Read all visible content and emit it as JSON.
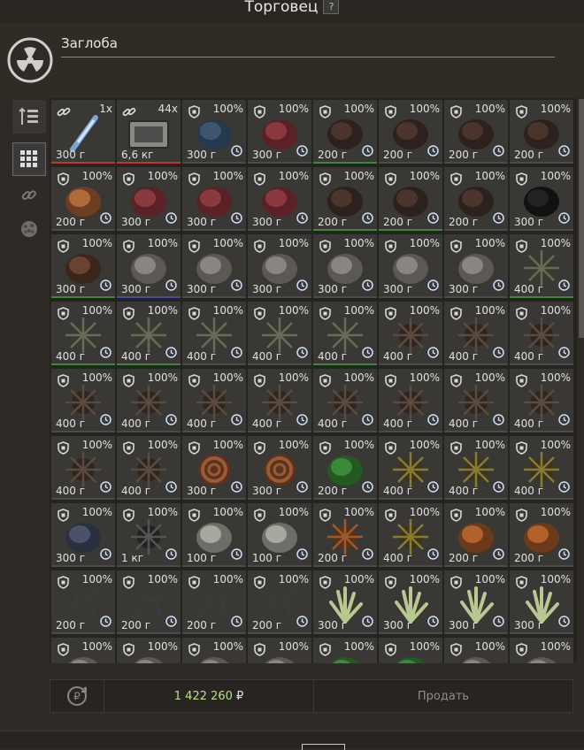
{
  "window": {
    "title": "Торговец",
    "help_label": "?"
  },
  "trader": {
    "name": "Заглоба",
    "avatar_icon": "radiation-icon"
  },
  "sidebar": {
    "buttons": [
      {
        "icon": "sort-icon"
      },
      {
        "icon": "grid-icon"
      },
      {
        "icon": "link-icon"
      },
      {
        "icon": "artifact-icon"
      }
    ]
  },
  "grid": {
    "columns": 8,
    "cells": [
      {
        "type": "link",
        "count": "1x",
        "weight": "300 г",
        "art": "injector",
        "bar": "#c0392b"
      },
      {
        "type": "link",
        "count": "44x",
        "weight": "6,6 кг",
        "art": "case",
        "bar": "#c0392b"
      },
      {
        "type": "shield",
        "pct": "100%",
        "weight": "300 г",
        "art": "blue",
        "bar": "#4a4a4a"
      },
      {
        "type": "shield",
        "pct": "100%",
        "weight": "300 г",
        "art": "red",
        "bar": "#4a4a4a"
      },
      {
        "type": "shield",
        "pct": "100%",
        "weight": "200 г",
        "art": "dark",
        "bar": "#3a8a3a"
      },
      {
        "type": "shield",
        "pct": "100%",
        "weight": "200 г",
        "art": "dark",
        "bar": "#4a4a4a"
      },
      {
        "type": "shield",
        "pct": "100%",
        "weight": "200 г",
        "art": "dark",
        "bar": "#4a4a4a"
      },
      {
        "type": "shield",
        "pct": "100%",
        "weight": "200 г",
        "art": "dark",
        "bar": "#4a4a4a"
      },
      {
        "type": "shield",
        "pct": "100%",
        "weight": "200 г",
        "art": "orange",
        "bar": "#4a4a4a"
      },
      {
        "type": "shield",
        "pct": "100%",
        "weight": "300 г",
        "art": "red",
        "bar": "#4a4a4a"
      },
      {
        "type": "shield",
        "pct": "100%",
        "weight": "300 г",
        "art": "red",
        "bar": "#4a4a4a"
      },
      {
        "type": "shield",
        "pct": "100%",
        "weight": "300 г",
        "art": "red",
        "bar": "#4a4a4a"
      },
      {
        "type": "shield",
        "pct": "100%",
        "weight": "200 г",
        "art": "dark",
        "bar": "#3a8a3a"
      },
      {
        "type": "shield",
        "pct": "100%",
        "weight": "200 г",
        "art": "dark",
        "bar": "#3a8a3a"
      },
      {
        "type": "shield",
        "pct": "100%",
        "weight": "200 г",
        "art": "dark",
        "bar": "#4a4a4a"
      },
      {
        "type": "shield",
        "pct": "100%",
        "weight": "300 г",
        "art": "black",
        "bar": "#4a4a4a"
      },
      {
        "type": "shield",
        "pct": "100%",
        "weight": "300 г",
        "art": "brown",
        "bar": "#3a8a3a"
      },
      {
        "type": "shield",
        "pct": "100%",
        "weight": "300 г",
        "art": "grey",
        "bar": "#4a4aa0"
      },
      {
        "type": "shield",
        "pct": "100%",
        "weight": "300 г",
        "art": "grey",
        "bar": "#4a4a4a"
      },
      {
        "type": "shield",
        "pct": "100%",
        "weight": "300 г",
        "art": "grey",
        "bar": "#4a4a4a"
      },
      {
        "type": "shield",
        "pct": "100%",
        "weight": "300 г",
        "art": "grey",
        "bar": "#4a4a4a"
      },
      {
        "type": "shield",
        "pct": "100%",
        "weight": "300 г",
        "art": "grey",
        "bar": "#4a4a4a"
      },
      {
        "type": "shield",
        "pct": "100%",
        "weight": "300 г",
        "art": "grey",
        "bar": "#4a4a4a"
      },
      {
        "type": "shield",
        "pct": "100%",
        "weight": "400 г",
        "art": "spiky",
        "bar": "#3a8a3a"
      },
      {
        "type": "shield",
        "pct": "100%",
        "weight": "400 г",
        "art": "spiky",
        "bar": "#3a8a3a"
      },
      {
        "type": "shield",
        "pct": "100%",
        "weight": "400 г",
        "art": "spiky",
        "bar": "#3a8a3a"
      },
      {
        "type": "shield",
        "pct": "100%",
        "weight": "400 г",
        "art": "spiky",
        "bar": "#4a4a4a"
      },
      {
        "type": "shield",
        "pct": "100%",
        "weight": "400 г",
        "art": "spiky",
        "bar": "#4a4a4a"
      },
      {
        "type": "shield",
        "pct": "100%",
        "weight": "400 г",
        "art": "spiky",
        "bar": "#3a8a3a"
      },
      {
        "type": "shield",
        "pct": "100%",
        "weight": "400 г",
        "art": "darkspiky",
        "bar": "#4a4a4a"
      },
      {
        "type": "shield",
        "pct": "100%",
        "weight": "400 г",
        "art": "darkspiky",
        "bar": "#4a4a4a"
      },
      {
        "type": "shield",
        "pct": "100%",
        "weight": "400 г",
        "art": "darkspiky",
        "bar": "#4a4a4a"
      },
      {
        "type": "shield",
        "pct": "100%",
        "weight": "400 г",
        "art": "darkspiky",
        "bar": "#4a4a4a"
      },
      {
        "type": "shield",
        "pct": "100%",
        "weight": "400 г",
        "art": "darkspiky",
        "bar": "#4a4a4a"
      },
      {
        "type": "shield",
        "pct": "100%",
        "weight": "400 г",
        "art": "darkspiky",
        "bar": "#4a4a4a"
      },
      {
        "type": "shield",
        "pct": "100%",
        "weight": "400 г",
        "art": "darkspiky",
        "bar": "#4a4a4a"
      },
      {
        "type": "shield",
        "pct": "100%",
        "weight": "400 г",
        "art": "darkspiky",
        "bar": "#4a4a4a"
      },
      {
        "type": "shield",
        "pct": "100%",
        "weight": "400 г",
        "art": "darkspiky",
        "bar": "#4a4a4a"
      },
      {
        "type": "shield",
        "pct": "100%",
        "weight": "400 г",
        "art": "darkspiky",
        "bar": "#4a4a4a"
      },
      {
        "type": "shield",
        "pct": "100%",
        "weight": "400 г",
        "art": "darkspiky",
        "bar": "#4a4a4a"
      },
      {
        "type": "shield",
        "pct": "100%",
        "weight": "400 г",
        "art": "darkspiky",
        "bar": "#4a4a4a"
      },
      {
        "type": "shield",
        "pct": "100%",
        "weight": "400 г",
        "art": "darkspiky",
        "bar": "#4a4a4a"
      },
      {
        "type": "shield",
        "pct": "100%",
        "weight": "300 г",
        "art": "spiral",
        "bar": "#4a4a4a"
      },
      {
        "type": "shield",
        "pct": "100%",
        "weight": "300 г",
        "art": "spiral",
        "bar": "#4a4a4a"
      },
      {
        "type": "shield",
        "pct": "100%",
        "weight": "200 г",
        "art": "green",
        "bar": "#4a4a4a"
      },
      {
        "type": "shield",
        "pct": "100%",
        "weight": "400 г",
        "art": "goldspiky",
        "bar": "#4a4a4a"
      },
      {
        "type": "shield",
        "pct": "100%",
        "weight": "400 г",
        "art": "goldspiky",
        "bar": "#4a4a4a"
      },
      {
        "type": "shield",
        "pct": "100%",
        "weight": "400 г",
        "art": "goldspiky",
        "bar": "#4a4a4a"
      },
      {
        "type": "shield",
        "pct": "100%",
        "weight": "300 г",
        "art": "navy",
        "bar": "#4a4a4a"
      },
      {
        "type": "shield",
        "pct": "100%",
        "weight": "1 кг",
        "art": "blackstar",
        "bar": "#4a4a4a"
      },
      {
        "type": "shield",
        "pct": "100%",
        "weight": "100 г",
        "art": "whitegrey",
        "bar": "#4a4a4a"
      },
      {
        "type": "shield",
        "pct": "100%",
        "weight": "100 г",
        "art": "whitegrey",
        "bar": "#4a4a4a"
      },
      {
        "type": "shield",
        "pct": "100%",
        "weight": "200 г",
        "art": "orangespiky",
        "bar": "#4a4a4a"
      },
      {
        "type": "shield",
        "pct": "100%",
        "weight": "400 г",
        "art": "goldspiky",
        "bar": "#4a4a4a"
      },
      {
        "type": "shield",
        "pct": "100%",
        "weight": "200 г",
        "art": "orangeberry",
        "bar": "#4a4a4a"
      },
      {
        "type": "shield",
        "pct": "100%",
        "weight": "200 г",
        "art": "orangeberry",
        "bar": "#4a4a4a"
      },
      {
        "type": "shield",
        "pct": "100%",
        "weight": "200 г",
        "art": "blackbranch",
        "bar": "#4a4a4a"
      },
      {
        "type": "shield",
        "pct": "100%",
        "weight": "200 г",
        "art": "blackbranch",
        "bar": "#4a4a4a"
      },
      {
        "type": "shield",
        "pct": "100%",
        "weight": "200 г",
        "art": "blackbranch",
        "bar": "#4a4a4a"
      },
      {
        "type": "shield",
        "pct": "100%",
        "weight": "200 г",
        "art": "blackbranch",
        "bar": "#4a4a4a"
      },
      {
        "type": "shield",
        "pct": "100%",
        "weight": "300 г",
        "art": "plant",
        "bar": "#4a4a4a"
      },
      {
        "type": "shield",
        "pct": "100%",
        "weight": "300 г",
        "art": "plant",
        "bar": "#4a4a4a"
      },
      {
        "type": "shield",
        "pct": "100%",
        "weight": "300 г",
        "art": "plant",
        "bar": "#4a4a4a"
      },
      {
        "type": "shield",
        "pct": "100%",
        "weight": "300 г",
        "art": "plant",
        "bar": "#4a4a4a"
      },
      {
        "type": "shield",
        "pct": "100%",
        "weight": "",
        "art": "grey",
        "bar": "#4a4a4a"
      },
      {
        "type": "shield",
        "pct": "100%",
        "weight": "",
        "art": "grey",
        "bar": "#4a4a4a"
      },
      {
        "type": "shield",
        "pct": "100%",
        "weight": "",
        "art": "grey",
        "bar": "#4a4a4a"
      },
      {
        "type": "shield",
        "pct": "100%",
        "weight": "",
        "art": "grey",
        "bar": "#4a4a4a"
      },
      {
        "type": "shield",
        "pct": "100%",
        "weight": "",
        "art": "green",
        "bar": "#4a4a4a"
      },
      {
        "type": "shield",
        "pct": "100%",
        "weight": "",
        "art": "green",
        "bar": "#4a4a4a"
      },
      {
        "type": "shield",
        "pct": "100%",
        "weight": "",
        "art": "grey",
        "bar": "#4a4a4a"
      },
      {
        "type": "shield",
        "pct": "100%",
        "weight": "",
        "art": "grey",
        "bar": "#4a4a4a"
      }
    ]
  },
  "footer": {
    "total": "1 422 260",
    "currency": "₽",
    "sell_label": "Продать",
    "total_color": "#b8e08a"
  }
}
